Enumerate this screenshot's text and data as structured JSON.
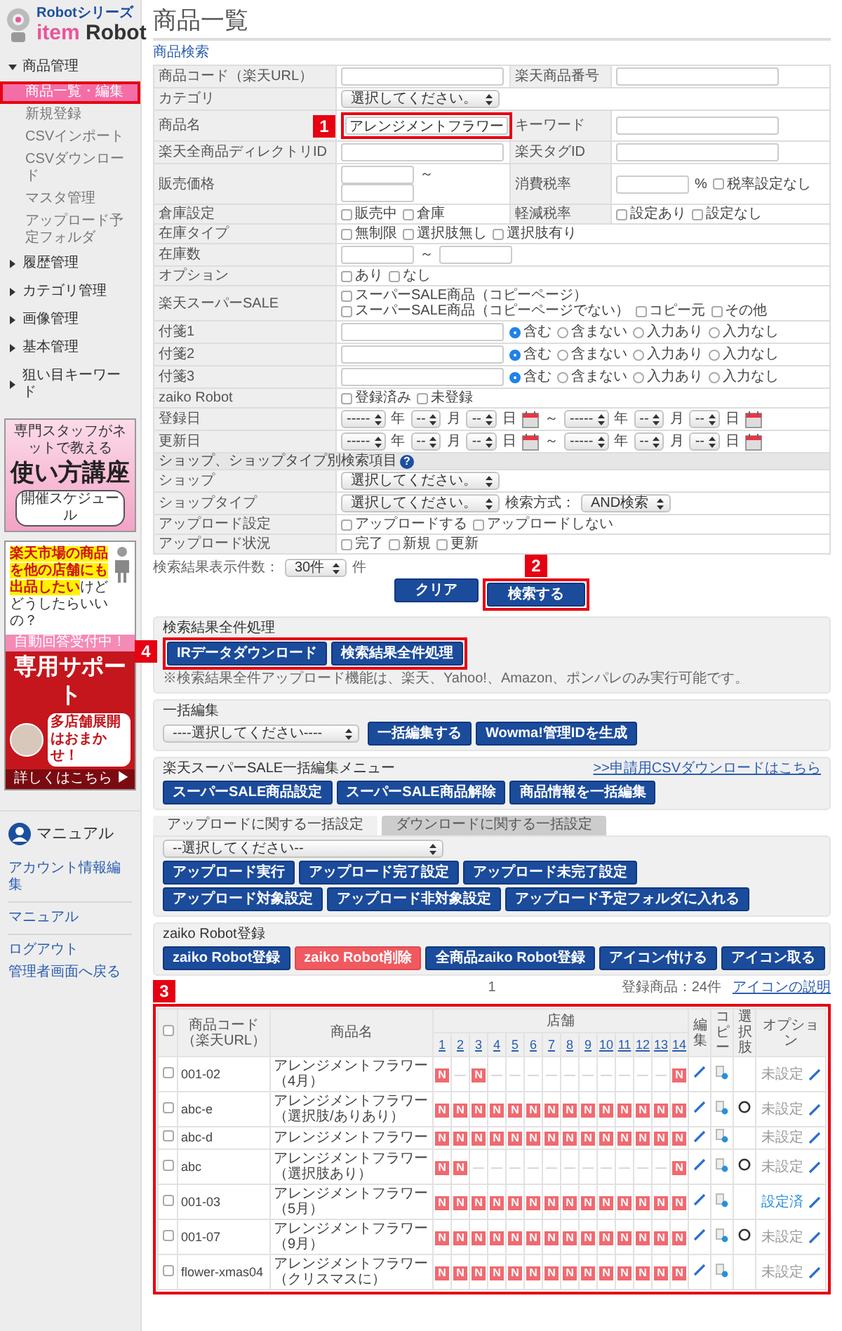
{
  "sidebar": {
    "logo": {
      "series": "Robotシリーズ",
      "name": [
        "item",
        "Robot"
      ]
    },
    "nav": [
      {
        "label": "商品管理",
        "expanded": true,
        "children": [
          {
            "label": "商品一覧・編集",
            "selected": true,
            "highlighted": true
          },
          {
            "label": "新規登録",
            "selected": false,
            "highlighted": false
          },
          {
            "label": "CSVインポート",
            "selected": false,
            "highlighted": false
          },
          {
            "label": "CSVダウンロード",
            "selected": false,
            "highlighted": false
          },
          {
            "label": "マスタ管理",
            "selected": false,
            "highlighted": false
          },
          {
            "label": "アップロード予定フォルダ",
            "selected": false,
            "highlighted": false
          }
        ]
      },
      {
        "label": "履歴管理",
        "expanded": false
      },
      {
        "label": "カテゴリ管理",
        "expanded": false
      },
      {
        "label": "画像管理",
        "expanded": false
      },
      {
        "label": "基本管理",
        "expanded": false
      },
      {
        "label": "狙い目キーワード",
        "expanded": false
      }
    ],
    "course_banner": {
      "kicker": "専門スタッフがネットで教える",
      "title": "使い方講座",
      "button": "開催スケジュール"
    },
    "support_banner": {
      "question": [
        {
          "text": "楽天市場の商品を",
          "highlighted": true
        },
        {
          "text": "他の店舗にも出品したい",
          "highlighted": true
        },
        {
          "text": "けどどうしたらいいの？",
          "highlighted": false
        }
      ],
      "ribbon": "自動回答受付中！",
      "title": "専用サポート",
      "tagline": "多店舗展開はおまかせ！",
      "link": "詳しくはこちら ▶"
    },
    "manual": {
      "title": "マニュアル",
      "groups": [
        [
          "アカウント情報編集"
        ],
        [
          "マニュアル"
        ],
        [
          "ログアウト",
          "管理者画面へ戻る"
        ]
      ]
    }
  },
  "page_title": "商品一覧",
  "search": {
    "title": "商品検索",
    "rows": [
      {
        "fields": [
          {
            "label": "商品コード（楽天URL）",
            "controls": [
              {
                "kind": "input"
              }
            ]
          },
          {
            "label": "楽天商品番号",
            "controls": [
              {
                "kind": "input"
              }
            ]
          }
        ]
      },
      {
        "fields": [
          {
            "label": "カテゴリ",
            "controls": [
              {
                "kind": "select",
                "value": "選択してください。"
              }
            ]
          }
        ]
      },
      {
        "fields": [
          {
            "label": "商品名",
            "controls": [
              {
                "kind": "input",
                "value": "アレンジメントフラワー",
                "callout": "1"
              }
            ]
          },
          {
            "label": "キーワード",
            "controls": [
              {
                "kind": "input"
              }
            ]
          }
        ]
      },
      {
        "fields": [
          {
            "label": "楽天全商品ディレクトリID",
            "controls": [
              {
                "kind": "input"
              }
            ]
          },
          {
            "label": "楽天タグID",
            "controls": [
              {
                "kind": "input"
              }
            ]
          }
        ]
      },
      {
        "fields": [
          {
            "label": "販売価格",
            "controls": [
              {
                "kind": "short_input"
              },
              {
                "kind": "text",
                "text": "～"
              },
              {
                "kind": "short_input"
              }
            ]
          },
          {
            "label": "消費税率",
            "controls": [
              {
                "kind": "short_input"
              },
              {
                "kind": "text",
                "text": "%"
              },
              {
                "kind": "check",
                "label": "税率設定なし",
                "checked": false
              }
            ]
          }
        ]
      },
      {
        "fields": [
          {
            "label": "倉庫設定",
            "controls": [
              {
                "kind": "check",
                "label": "販売中",
                "checked": false
              },
              {
                "kind": "check",
                "label": "倉庫",
                "checked": false
              }
            ]
          },
          {
            "label": "軽減税率",
            "controls": [
              {
                "kind": "check",
                "label": "設定あり",
                "checked": false
              },
              {
                "kind": "check",
                "label": "設定なし",
                "checked": false
              }
            ]
          }
        ]
      },
      {
        "fields": [
          {
            "label": "在庫タイプ",
            "controls": [
              {
                "kind": "check",
                "label": "無制限",
                "checked": false
              },
              {
                "kind": "check",
                "label": "選択肢無し",
                "checked": false
              },
              {
                "kind": "check",
                "label": "選択肢有り",
                "checked": false
              }
            ]
          }
        ]
      },
      {
        "fields": [
          {
            "label": "在庫数",
            "controls": [
              {
                "kind": "short_input"
              },
              {
                "kind": "text",
                "text": "～"
              },
              {
                "kind": "short_input"
              }
            ]
          }
        ]
      },
      {
        "fields": [
          {
            "label": "オプション",
            "controls": [
              {
                "kind": "check",
                "label": "あり",
                "checked": false
              },
              {
                "kind": "check",
                "label": "なし",
                "checked": false
              }
            ]
          }
        ]
      },
      {
        "fields": [
          {
            "label": "楽天スーパーSALE",
            "controls": [
              {
                "kind": "check",
                "label": "スーパーSALE商品（コピーページ）",
                "checked": false
              },
              {
                "kind": "check",
                "label": "スーパーSALE商品（コピーページでない）",
                "checked": false
              },
              {
                "kind": "check",
                "label": "コピー元",
                "checked": false
              },
              {
                "kind": "check",
                "label": "その他",
                "checked": false
              }
            ]
          }
        ]
      },
      {
        "fields": [
          {
            "label": "付箋1",
            "controls": [
              {
                "kind": "input"
              },
              {
                "kind": "radio",
                "label": "含む",
                "selected": true
              },
              {
                "kind": "radio",
                "label": "含まない",
                "selected": false
              },
              {
                "kind": "radio",
                "label": "入力あり",
                "selected": false
              },
              {
                "kind": "radio",
                "label": "入力なし",
                "selected": false
              }
            ]
          }
        ]
      },
      {
        "fields": [
          {
            "label": "付箋2",
            "controls": [
              {
                "kind": "input"
              },
              {
                "kind": "radio",
                "label": "含む",
                "selected": true
              },
              {
                "kind": "radio",
                "label": "含まない",
                "selected": false
              },
              {
                "kind": "radio",
                "label": "入力あり",
                "selected": false
              },
              {
                "kind": "radio",
                "label": "入力なし",
                "selected": false
              }
            ]
          }
        ]
      },
      {
        "fields": [
          {
            "label": "付箋3",
            "controls": [
              {
                "kind": "input"
              },
              {
                "kind": "radio",
                "label": "含む",
                "selected": true
              },
              {
                "kind": "radio",
                "label": "含まない",
                "selected": false
              },
              {
                "kind": "radio",
                "label": "入力あり",
                "selected": false
              },
              {
                "kind": "radio",
                "label": "入力なし",
                "selected": false
              }
            ]
          }
        ]
      },
      {
        "fields": [
          {
            "label": "zaiko Robot",
            "controls": [
              {
                "kind": "check",
                "label": "登録済み",
                "checked": false
              },
              {
                "kind": "check",
                "label": "未登録",
                "checked": false
              }
            ]
          }
        ]
      },
      {
        "fields": [
          {
            "label": "登録日",
            "controls": [
              {
                "kind": "date_select",
                "value": "-----"
              },
              {
                "kind": "text",
                "text": "年"
              },
              {
                "kind": "date_select",
                "value": "--"
              },
              {
                "kind": "text",
                "text": "月"
              },
              {
                "kind": "date_select",
                "value": "--"
              },
              {
                "kind": "text",
                "text": "日"
              },
              {
                "kind": "calendar"
              },
              {
                "kind": "text",
                "text": "～"
              },
              {
                "kind": "date_select",
                "value": "-----"
              },
              {
                "kind": "text",
                "text": "年"
              },
              {
                "kind": "date_select",
                "value": "--"
              },
              {
                "kind": "text",
                "text": "月"
              },
              {
                "kind": "date_select",
                "value": "--"
              },
              {
                "kind": "text",
                "text": "日"
              },
              {
                "kind": "calendar"
              }
            ]
          }
        ]
      },
      {
        "fields": [
          {
            "label": "更新日",
            "controls": [
              {
                "kind": "date_select",
                "value": "-----"
              },
              {
                "kind": "text",
                "text": "年"
              },
              {
                "kind": "date_select",
                "value": "--"
              },
              {
                "kind": "text",
                "text": "月"
              },
              {
                "kind": "date_select",
                "value": "--"
              },
              {
                "kind": "text",
                "text": "日"
              },
              {
                "kind": "calendar"
              },
              {
                "kind": "text",
                "text": "～"
              },
              {
                "kind": "date_select",
                "value": "-----"
              },
              {
                "kind": "text",
                "text": "年"
              },
              {
                "kind": "date_select",
                "value": "--"
              },
              {
                "kind": "text",
                "text": "月"
              },
              {
                "kind": "date_select",
                "value": "--"
              },
              {
                "kind": "text",
                "text": "日"
              },
              {
                "kind": "calendar"
              }
            ]
          }
        ]
      },
      {
        "heading": "ショップ、ショップタイプ別検索項目",
        "help": "?"
      },
      {
        "fields": [
          {
            "label": "ショップ",
            "controls": [
              {
                "kind": "select",
                "value": "選択してください。"
              }
            ]
          }
        ]
      },
      {
        "fields": [
          {
            "label": "ショップタイプ",
            "controls": [
              {
                "kind": "select",
                "value": "選択してください。"
              },
              {
                "kind": "text",
                "text": "検索方式："
              },
              {
                "kind": "select",
                "value": "AND検索"
              }
            ]
          }
        ]
      },
      {
        "fields": [
          {
            "label": "アップロード設定",
            "controls": [
              {
                "kind": "check",
                "label": "アップロードする",
                "checked": false
              },
              {
                "kind": "check",
                "label": "アップロードしない",
                "checked": false
              }
            ]
          }
        ]
      },
      {
        "fields": [
          {
            "label": "アップロード状況",
            "controls": [
              {
                "kind": "check",
                "label": "完了",
                "checked": false
              },
              {
                "kind": "check",
                "label": "新規",
                "checked": false
              },
              {
                "kind": "check",
                "label": "更新",
                "checked": false
              }
            ]
          }
        ]
      }
    ],
    "per_page_label": "検索結果表示件数：",
    "per_page": "30件",
    "per_page_unit": "件",
    "buttons": [
      {
        "label": "クリア"
      },
      {
        "label": "検索する",
        "callout": "2"
      }
    ]
  },
  "result_actions": {
    "title": "検索結果全件処理",
    "callout": "4",
    "button_rows": [
      [
        {
          "label": "IRデータダウンロード",
          "kind": "primary"
        },
        {
          "label": "検索結果全件処理",
          "kind": "primary"
        }
      ]
    ],
    "note": "※検索結果全件アップロード機能は、楽天、Yahoo!、Amazon、ポンパレのみ実行可能です。"
  },
  "bulk_edit": {
    "title": "一括編集",
    "select": "----選択してください----",
    "button_rows": [
      [
        {
          "label": "一括編集する",
          "kind": "primary"
        },
        {
          "label": "Wowma!管理IDを生成",
          "kind": "primary"
        }
      ]
    ]
  },
  "super_sale": {
    "title": "楽天スーパーSALE一括編集メニュー",
    "link": ">>申請用CSVダウンロードはこちら",
    "button_rows": [
      [
        {
          "label": "スーパーSALE商品設定",
          "kind": "primary"
        },
        {
          "label": "スーパーSALE商品解除",
          "kind": "primary"
        },
        {
          "label": "商品情報を一括編集",
          "kind": "primary"
        }
      ]
    ]
  },
  "bulk_settings": {
    "tabs": [
      {
        "label": "アップロードに関する一括設定",
        "selected": true
      },
      {
        "label": "ダウンロードに関する一括設定",
        "selected": false
      }
    ],
    "select": "--選択してください--",
    "button_rows": [
      [
        {
          "label": "アップロード実行",
          "kind": "primary"
        },
        {
          "label": "アップロード完了設定",
          "kind": "primary"
        },
        {
          "label": "アップロード未完了設定",
          "kind": "primary"
        }
      ],
      [
        {
          "label": "アップロード対象設定",
          "kind": "primary"
        },
        {
          "label": "アップロード非対象設定",
          "kind": "primary"
        },
        {
          "label": "アップロード予定フォルダに入れる",
          "kind": "primary"
        }
      ]
    ]
  },
  "zaiko": {
    "title": "zaiko Robot登録",
    "button_rows": [
      [
        {
          "label": "zaiko Robot登録",
          "kind": "primary"
        },
        {
          "label": "zaiko Robot削除",
          "kind": "danger"
        },
        {
          "label": "全商品zaiko Robot登録",
          "kind": "primary"
        },
        {
          "label": "アイコン付ける",
          "kind": "primary"
        },
        {
          "label": "アイコン取る",
          "kind": "primary"
        }
      ]
    ]
  },
  "results": {
    "count": "登録商品：24件",
    "legend_link": "アイコンの説明",
    "pagination": [
      "1"
    ],
    "callout": "3",
    "select_all_checked": false,
    "columns": {
      "code": "商品コード（楽天URL）",
      "name": "商品名",
      "shops": "店舗",
      "shop_numbers": [
        "1",
        "2",
        "3",
        "4",
        "5",
        "6",
        "7",
        "8",
        "9",
        "10",
        "11",
        "12",
        "13",
        "14"
      ],
      "edit": "編集",
      "copy": "コピー",
      "choices": "選択肢",
      "option": "オプション"
    },
    "rows": [
      {
        "checked": false,
        "code": "001-02",
        "name": "アレンジメントフラワー（4月）",
        "has_choices": false,
        "option_status": "未設定",
        "option_set": false,
        "shops": [
          {
            "mark": "N",
            "listed": true
          },
          {
            "mark": "—",
            "listed": false
          },
          {
            "mark": "N",
            "listed": true
          },
          {
            "mark": "—",
            "listed": false
          },
          {
            "mark": "—",
            "listed": false
          },
          {
            "mark": "—",
            "listed": false
          },
          {
            "mark": "—",
            "listed": false
          },
          {
            "mark": "—",
            "listed": false
          },
          {
            "mark": "—",
            "listed": false
          },
          {
            "mark": "—",
            "listed": false
          },
          {
            "mark": "—",
            "listed": false
          },
          {
            "mark": "—",
            "listed": false
          },
          {
            "mark": "—",
            "listed": false
          },
          {
            "mark": "N",
            "listed": true
          }
        ]
      },
      {
        "checked": false,
        "code": "abc-e",
        "name": "アレンジメントフラワー（選択肢/ありあり）",
        "has_choices": true,
        "option_status": "未設定",
        "option_set": false,
        "shops": [
          {
            "mark": "N",
            "listed": true
          },
          {
            "mark": "N",
            "listed": true
          },
          {
            "mark": "N",
            "listed": true
          },
          {
            "mark": "N",
            "listed": true
          },
          {
            "mark": "N",
            "listed": true
          },
          {
            "mark": "N",
            "listed": true
          },
          {
            "mark": "N",
            "listed": true
          },
          {
            "mark": "N",
            "listed": true
          },
          {
            "mark": "N",
            "listed": true
          },
          {
            "mark": "N",
            "listed": true
          },
          {
            "mark": "N",
            "listed": true
          },
          {
            "mark": "N",
            "listed": true
          },
          {
            "mark": "N",
            "listed": true
          },
          {
            "mark": "N",
            "listed": true
          }
        ]
      },
      {
        "checked": false,
        "code": "abc-d",
        "name": "アレンジメントフラワー",
        "has_choices": false,
        "option_status": "未設定",
        "option_set": false,
        "shops": [
          {
            "mark": "N",
            "listed": true
          },
          {
            "mark": "N",
            "listed": true
          },
          {
            "mark": "N",
            "listed": true
          },
          {
            "mark": "N",
            "listed": true
          },
          {
            "mark": "N",
            "listed": true
          },
          {
            "mark": "N",
            "listed": true
          },
          {
            "mark": "N",
            "listed": true
          },
          {
            "mark": "N",
            "listed": true
          },
          {
            "mark": "N",
            "listed": true
          },
          {
            "mark": "N",
            "listed": true
          },
          {
            "mark": "N",
            "listed": true
          },
          {
            "mark": "N",
            "listed": true
          },
          {
            "mark": "N",
            "listed": true
          },
          {
            "mark": "N",
            "listed": true
          }
        ]
      },
      {
        "checked": false,
        "code": "abc",
        "name": "アレンジメントフラワー（選択肢あり）",
        "has_choices": true,
        "option_status": "未設定",
        "option_set": false,
        "shops": [
          {
            "mark": "N",
            "listed": true
          },
          {
            "mark": "N",
            "listed": true
          },
          {
            "mark": "—",
            "listed": false
          },
          {
            "mark": "—",
            "listed": false
          },
          {
            "mark": "—",
            "listed": false
          },
          {
            "mark": "—",
            "listed": false
          },
          {
            "mark": "—",
            "listed": false
          },
          {
            "mark": "—",
            "listed": false
          },
          {
            "mark": "—",
            "listed": false
          },
          {
            "mark": "—",
            "listed": false
          },
          {
            "mark": "—",
            "listed": false
          },
          {
            "mark": "—",
            "listed": false
          },
          {
            "mark": "—",
            "listed": false
          },
          {
            "mark": "N",
            "listed": true
          }
        ]
      },
      {
        "checked": false,
        "code": "001-03",
        "name": "アレンジメントフラワー（5月）",
        "has_choices": false,
        "option_status": "設定済",
        "option_set": true,
        "shops": [
          {
            "mark": "N",
            "listed": true
          },
          {
            "mark": "N",
            "listed": true
          },
          {
            "mark": "N",
            "listed": true
          },
          {
            "mark": "N",
            "listed": true
          },
          {
            "mark": "N",
            "listed": true
          },
          {
            "mark": "N",
            "listed": true
          },
          {
            "mark": "N",
            "listed": true
          },
          {
            "mark": "N",
            "listed": true
          },
          {
            "mark": "N",
            "listed": true
          },
          {
            "mark": "N",
            "listed": true
          },
          {
            "mark": "N",
            "listed": true
          },
          {
            "mark": "N",
            "listed": true
          },
          {
            "mark": "N",
            "listed": true
          },
          {
            "mark": "N",
            "listed": true
          }
        ]
      },
      {
        "checked": false,
        "code": "001-07",
        "name": "アレンジメントフラワー（9月）",
        "has_choices": true,
        "option_status": "未設定",
        "option_set": false,
        "shops": [
          {
            "mark": "N",
            "listed": true
          },
          {
            "mark": "N",
            "listed": true
          },
          {
            "mark": "N",
            "listed": true
          },
          {
            "mark": "N",
            "listed": true
          },
          {
            "mark": "N",
            "listed": true
          },
          {
            "mark": "N",
            "listed": true
          },
          {
            "mark": "N",
            "listed": true
          },
          {
            "mark": "N",
            "listed": true
          },
          {
            "mark": "N",
            "listed": true
          },
          {
            "mark": "N",
            "listed": true
          },
          {
            "mark": "N",
            "listed": true
          },
          {
            "mark": "N",
            "listed": true
          },
          {
            "mark": "N",
            "listed": true
          },
          {
            "mark": "N",
            "listed": true
          }
        ]
      },
      {
        "checked": false,
        "code": "flower-xmas04",
        "name": "アレンジメントフラワー（クリスマスに）",
        "has_choices": false,
        "option_status": "未設定",
        "option_set": false,
        "shops": [
          {
            "mark": "N",
            "listed": true
          },
          {
            "mark": "N",
            "listed": true
          },
          {
            "mark": "N",
            "listed": true
          },
          {
            "mark": "N",
            "listed": true
          },
          {
            "mark": "N",
            "listed": true
          },
          {
            "mark": "N",
            "listed": true
          },
          {
            "mark": "N",
            "listed": true
          },
          {
            "mark": "N",
            "listed": true
          },
          {
            "mark": "N",
            "listed": true
          },
          {
            "mark": "N",
            "listed": true
          },
          {
            "mark": "N",
            "listed": true
          },
          {
            "mark": "N",
            "listed": true
          },
          {
            "mark": "N",
            "listed": true
          },
          {
            "mark": "N",
            "listed": true
          }
        ]
      }
    ]
  }
}
